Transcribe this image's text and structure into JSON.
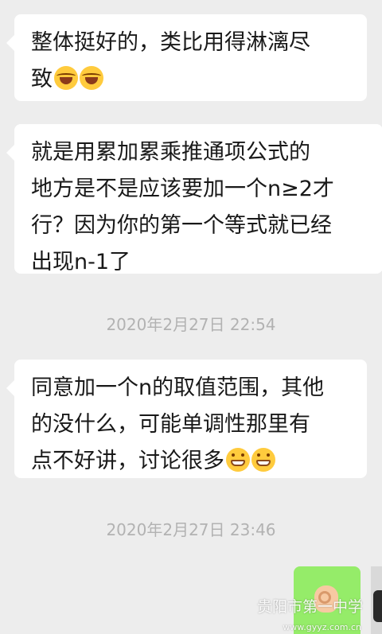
{
  "messages": [
    {
      "lines": [
        "整体挺好的，类比用得淋漓尽",
        "致"
      ],
      "emojis": [
        "laughing-crying-emoji",
        "laughing-crying-emoji"
      ]
    },
    {
      "lines": [
        "就是用累加累乘推通项公式的",
        "地方是不是应该要加一个n≥2才",
        "行？因为你的第一个等式就已经",
        "出现n-1了"
      ]
    },
    {
      "lines": [
        "同意加一个n的取值范围，其他",
        "的没什么，可能单调性那里有",
        "点不好讲，讨论很多"
      ],
      "emojis": [
        "grinning-face-emoji",
        "grinning-face-emoji"
      ]
    }
  ],
  "timestamps": [
    "2020年2月27日 22:54",
    "2020年2月27日 23:46"
  ],
  "outgoing_emoji": "ok-hand-emoji",
  "watermark": {
    "line1": "贵阳市第一中学",
    "line2": "www.gyyz.com.cn"
  },
  "colors": {
    "background": "#ededed",
    "incoming_bubble": "#ffffff",
    "outgoing_bubble": "#95ec69",
    "timestamp_text": "#b2b2b2"
  }
}
